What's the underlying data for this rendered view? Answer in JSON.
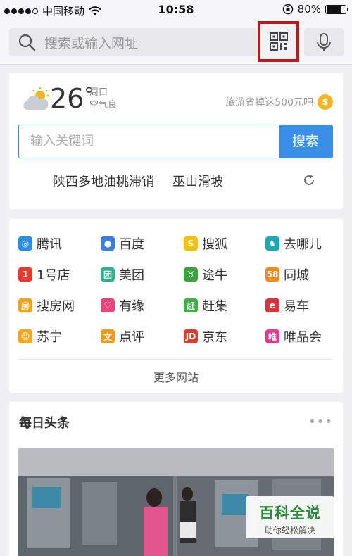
{
  "status_bar": {
    "carrier": "中国移动",
    "time": "10:58",
    "battery": "80%",
    "battery_level": 0.8
  },
  "search": {
    "placeholder": "搜索或输入网址"
  },
  "weather": {
    "temp": "26",
    "degree": "°",
    "day": "周口",
    "air": "空气良",
    "promo": "旅游省掉这500元吧",
    "coin": "$"
  },
  "keyword": {
    "placeholder": "输入关键词",
    "button": "搜索"
  },
  "hot": [
    "陕西多地油桃滞销",
    "巫山滑坡"
  ],
  "sites": [
    {
      "label": "腾讯",
      "icon": "tencent-icon",
      "glyph": "◎",
      "color": "#2a8de0"
    },
    {
      "label": "百度",
      "icon": "baidu-paw-icon",
      "glyph": "●",
      "color": "#3a7fe0"
    },
    {
      "label": "搜狐",
      "icon": "sohu-icon",
      "glyph": "S",
      "color": "#f2c200"
    },
    {
      "label": "去哪儿",
      "icon": "qunar-camel-icon",
      "glyph": "♞",
      "color": "#1ba8b8"
    },
    {
      "label": "1号店",
      "icon": "yhd-icon",
      "glyph": "1",
      "color": "#e8392c"
    },
    {
      "label": "美团",
      "icon": "meituan-icon",
      "glyph": "团",
      "color": "#2bb38a"
    },
    {
      "label": "途牛",
      "icon": "tuniu-icon",
      "glyph": "♉",
      "color": "#3aa33a"
    },
    {
      "label": "同城",
      "icon": "58-icon",
      "glyph": "58",
      "color": "#f08a1c"
    },
    {
      "label": "搜房网",
      "icon": "soufang-icon",
      "glyph": "房",
      "color": "#f6a21a"
    },
    {
      "label": "有缘",
      "icon": "youyuan-icon",
      "glyph": "♡",
      "color": "#e8437a"
    },
    {
      "label": "赶集",
      "icon": "ganji-icon",
      "glyph": "赶",
      "color": "#3fae45"
    },
    {
      "label": "易车",
      "icon": "yiche-icon",
      "glyph": "e",
      "color": "#d9333f"
    },
    {
      "label": "苏宁",
      "icon": "suning-icon",
      "glyph": "☺",
      "color": "#f5a623"
    },
    {
      "label": "点评",
      "icon": "dianping-icon",
      "glyph": "文",
      "color": "#f39a1d"
    },
    {
      "label": "京东",
      "icon": "jd-icon",
      "glyph": "JD",
      "color": "#e33a2f"
    },
    {
      "label": "唯品会",
      "icon": "vip-icon",
      "glyph": "唯",
      "color": "#e6398f"
    }
  ],
  "more_sites": "更多网站",
  "news": {
    "title": "每日头条",
    "menu": "•••"
  },
  "watermark": {
    "big": "百科全说",
    "small": "助你轻松解决"
  }
}
